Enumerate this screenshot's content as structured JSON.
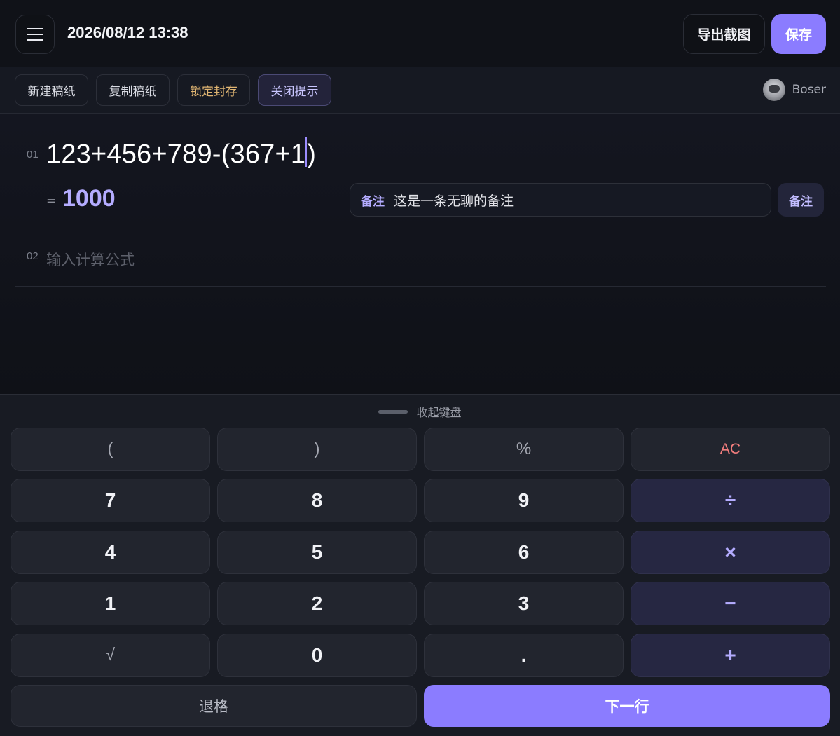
{
  "header": {
    "datetime": "2026/08/12 13:38",
    "export_label": "导出截图",
    "save_label": "保存"
  },
  "toolbar": {
    "new_label": "新建稿纸",
    "copy_label": "复制稿纸",
    "lock_label": "锁定封存",
    "hint_label": "关闭提示",
    "user_name": "Boser"
  },
  "lines": [
    {
      "number": "01",
      "expression": "123+456+789-(367+1",
      "expression_tail": ")",
      "equals_sign": "=",
      "result": "1000",
      "note_tag": "备注",
      "note_text": "这是一条无聊的备注",
      "note_button": "备注"
    },
    {
      "number": "02",
      "placeholder": "输入计算公式"
    }
  ],
  "keyboard": {
    "collapse_label": "收起键盘",
    "keys": {
      "lparen": "(",
      "rparen": ")",
      "percent": "%",
      "ac": "AC",
      "k7": "7",
      "k8": "8",
      "k9": "9",
      "divide": "÷",
      "k4": "4",
      "k5": "5",
      "k6": "6",
      "multiply": "×",
      "k1": "1",
      "k2": "2",
      "k3": "3",
      "minus": "−",
      "sqrt": "√",
      "k0": "0",
      "dot": ".",
      "plus": "+",
      "backspace": "退格",
      "next_line": "下一行"
    }
  },
  "colors": {
    "accent": "#8b7cff",
    "result": "#b4acff",
    "lock": "#e0b572",
    "clear": "#f27d7d",
    "background": "#0f1116"
  },
  "icons": {
    "menu": "menu-icon",
    "avatar": "robot-avatar"
  }
}
